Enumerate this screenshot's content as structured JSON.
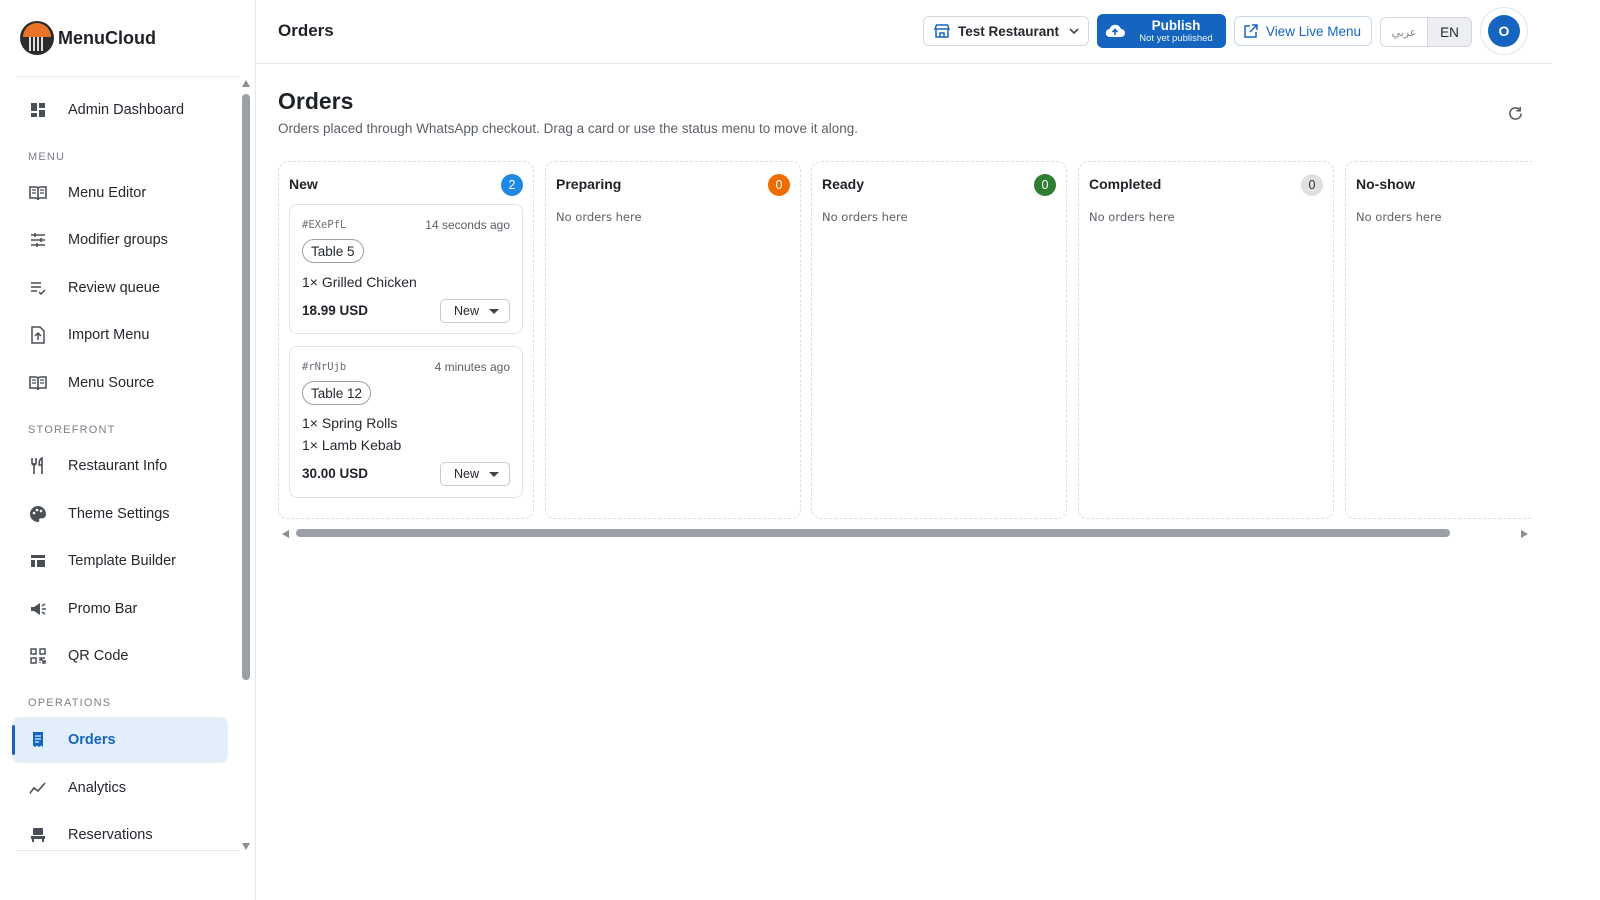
{
  "brand": {
    "name": "MenuCloud"
  },
  "sidebar": {
    "top_item": {
      "label": "Admin Dashboard",
      "icon": "dashboard-icon"
    },
    "sections": [
      {
        "title": "MENU",
        "items": [
          {
            "label": "Menu Editor",
            "icon": "book-icon"
          },
          {
            "label": "Modifier groups",
            "icon": "sliders-icon"
          },
          {
            "label": "Review queue",
            "icon": "checklist-icon"
          },
          {
            "label": "Import Menu",
            "icon": "file-upload-icon"
          },
          {
            "label": "Menu Source",
            "icon": "book-icon"
          }
        ]
      },
      {
        "title": "STOREFRONT",
        "items": [
          {
            "label": "Restaurant Info",
            "icon": "utensils-icon"
          },
          {
            "label": "Theme Settings",
            "icon": "palette-icon"
          },
          {
            "label": "Template Builder",
            "icon": "layout-icon"
          },
          {
            "label": "Promo Bar",
            "icon": "megaphone-icon"
          },
          {
            "label": "QR Code",
            "icon": "qr-code-icon"
          }
        ]
      },
      {
        "title": "OPERATIONS",
        "items": [
          {
            "label": "Orders",
            "icon": "receipt-icon",
            "active": true
          },
          {
            "label": "Analytics",
            "icon": "trend-icon"
          },
          {
            "label": "Reservations",
            "icon": "chair-icon"
          }
        ]
      }
    ]
  },
  "topbar": {
    "title": "Orders",
    "restaurant_selector": "Test Restaurant",
    "publish": {
      "label": "Publish",
      "status": "Not yet published"
    },
    "view_live": "View Live Menu",
    "languages": {
      "arabic": "عربي",
      "english": "EN",
      "selected": "EN"
    },
    "avatar_initial": "O"
  },
  "page": {
    "title": "Orders",
    "subtitle": "Orders placed through WhatsApp checkout. Drag a card or use the status menu to move it along."
  },
  "board": {
    "empty_text": "No orders here",
    "columns": [
      {
        "title": "New",
        "count": "2",
        "count_color": "#1e88e5",
        "orders": [
          {
            "id": "#EXePfL",
            "time": "14 seconds ago",
            "table": "Table 5",
            "items": [
              "1× Grilled Chicken"
            ],
            "total": "18.99 USD",
            "status": "New"
          },
          {
            "id": "#rNrUjb",
            "time": "4 minutes ago",
            "table": "Table 12",
            "items": [
              "1× Spring Rolls",
              "1× Lamb Kebab"
            ],
            "total": "30.00 USD",
            "status": "New"
          }
        ]
      },
      {
        "title": "Preparing",
        "count": "0",
        "count_color": "#ef6c00",
        "orders": []
      },
      {
        "title": "Ready",
        "count": "0",
        "count_color": "#2e7d32",
        "orders": []
      },
      {
        "title": "Completed",
        "count": "0",
        "count_color": "#e0e0e0",
        "count_text_color": "#333333",
        "orders": []
      },
      {
        "title": "No-show",
        "count": "",
        "orders": []
      }
    ]
  },
  "colors": {
    "primary": "#1565c0",
    "active_bg": "#e3eefb"
  }
}
